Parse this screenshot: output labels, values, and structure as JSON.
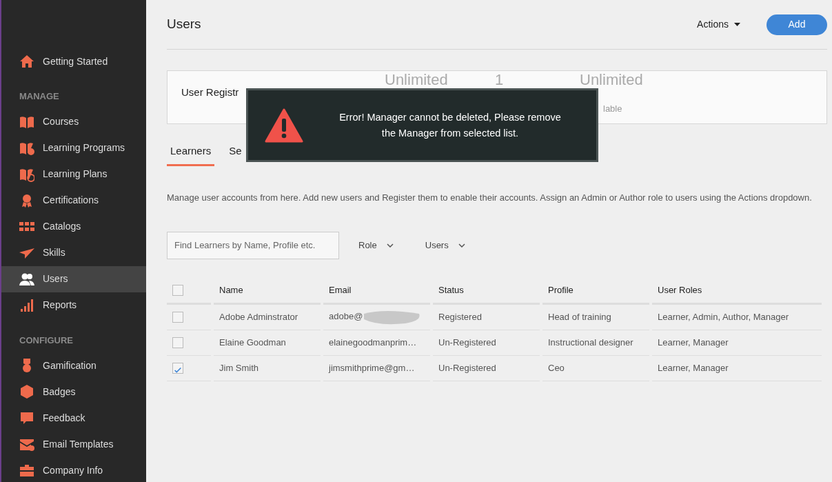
{
  "page": {
    "title": "Users",
    "actions_menu": "Actions",
    "add_button": "Add"
  },
  "sidebar": {
    "top_items": [
      {
        "label": "Getting Started",
        "selected": false
      }
    ],
    "sections": [
      {
        "heading": "MANAGE",
        "items": [
          {
            "label": "Courses",
            "selected": false
          },
          {
            "label": "Learning Programs",
            "selected": false
          },
          {
            "label": "Learning Plans",
            "selected": false
          },
          {
            "label": "Certifications",
            "selected": false
          },
          {
            "label": "Catalogs",
            "selected": false
          },
          {
            "label": "Skills",
            "selected": false
          },
          {
            "label": "Users",
            "selected": true
          },
          {
            "label": "Reports",
            "selected": false
          }
        ]
      },
      {
        "heading": "CONFIGURE",
        "items": [
          {
            "label": "Gamification",
            "selected": false
          },
          {
            "label": "Badges",
            "selected": false
          },
          {
            "label": "Feedback",
            "selected": false
          },
          {
            "label": "Email Templates",
            "selected": false
          },
          {
            "label": "Company Info",
            "selected": false
          }
        ]
      }
    ]
  },
  "registration_panel": {
    "label": "User Registr",
    "stats": [
      {
        "value": "Unlimited"
      },
      {
        "value": "1"
      },
      {
        "value": "Unlimited",
        "caption": "lable"
      }
    ]
  },
  "tabs": [
    {
      "label": "Learners",
      "selected": true
    },
    {
      "label": "Se",
      "selected": false
    }
  ],
  "description": "Manage user accounts from here. Add new users and Register them to enable their accounts. Assign an Admin or Author role to users using the Actions dropdown.",
  "filters": {
    "search": {
      "placeholder": "Find Learners by Name, Profile etc."
    },
    "dropdowns": [
      "Role",
      "Users"
    ]
  },
  "table": {
    "columns": [
      "Name",
      "Email",
      "Status",
      "Profile",
      "User Roles"
    ],
    "header_checked": false,
    "rows": [
      {
        "checked": false,
        "email_redacted": true,
        "cells": [
          "Adobe Adminstrator",
          "adobe@",
          "Registered",
          "Head of training",
          "Learner, Admin, Author, Manager"
        ]
      },
      {
        "checked": false,
        "email_redacted": false,
        "cells": [
          "Elaine Goodman",
          "elainegoodmanprim…",
          "Un-Registered",
          "Instructional designer",
          "Learner, Manager"
        ]
      },
      {
        "checked": true,
        "email_redacted": false,
        "cells": [
          "Jim Smith",
          "jimsmithprime@gm…",
          "Un-Registered",
          "Ceo",
          "Learner, Manager"
        ]
      }
    ]
  },
  "toast": {
    "message": "Error! Manager cannot be deleted, Please remove the Manager from selected list."
  }
}
